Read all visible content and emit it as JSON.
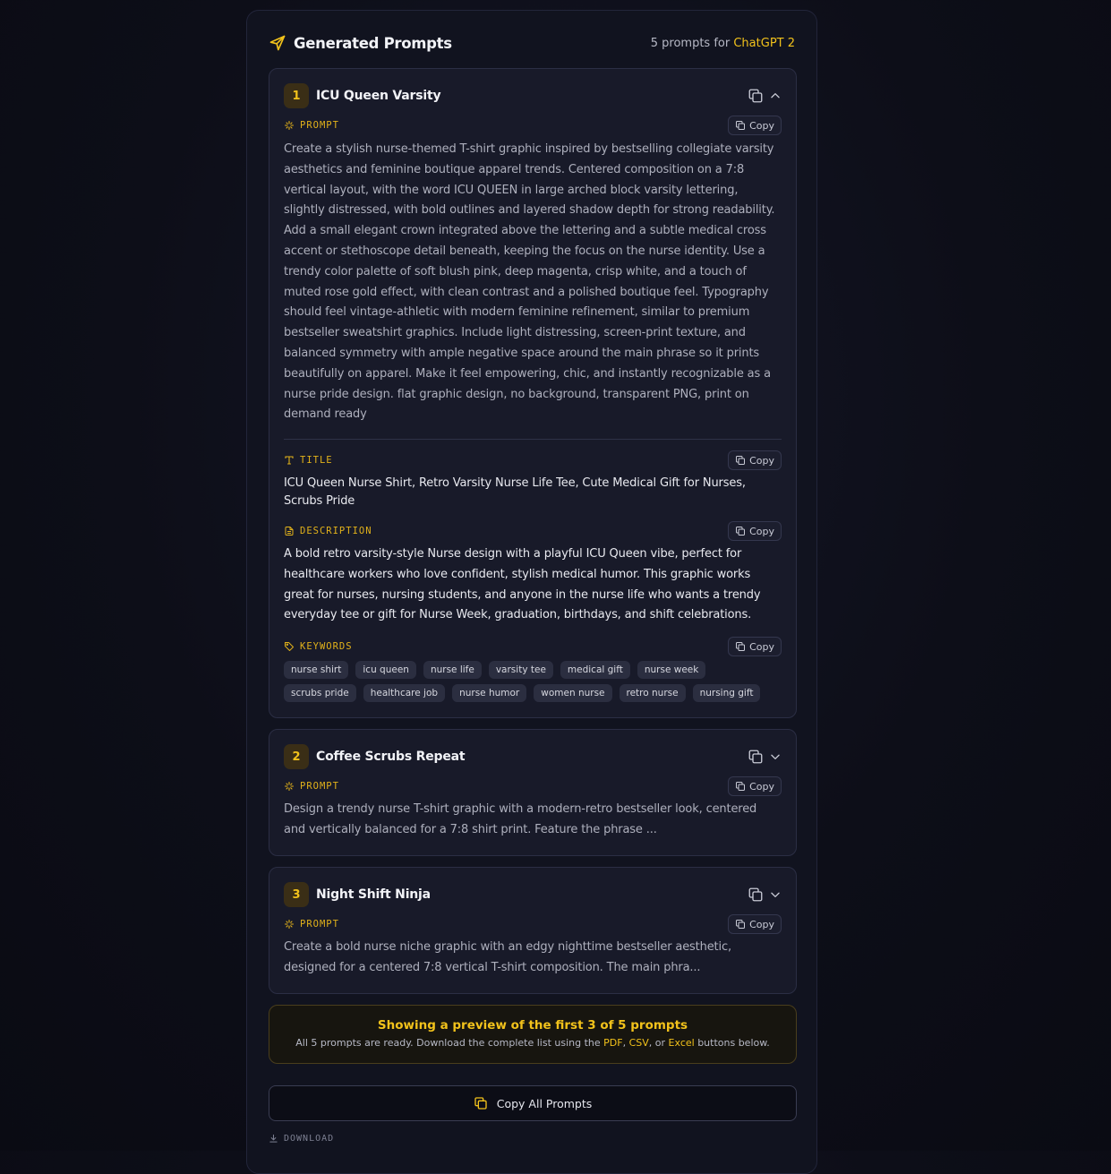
{
  "header": {
    "title": "Generated Prompts",
    "meta_prefix": "5 prompts for",
    "model": "ChatGPT 2"
  },
  "labels": {
    "prompt": "PROMPT",
    "title": "TITLE",
    "description": "DESCRIPTION",
    "keywords": "KEYWORDS",
    "copy": "Copy"
  },
  "cards": [
    {
      "number": "1",
      "name": "ICU Queen Varsity",
      "expanded": true,
      "prompt": "Create a stylish nurse-themed T-shirt graphic inspired by bestselling collegiate varsity aesthetics and feminine boutique apparel trends. Centered composition on a 7:8 vertical layout, with the word ICU QUEEN in large arched block varsity lettering, slightly distressed, with bold outlines and layered shadow depth for strong readability. Add a small elegant crown integrated above the lettering and a subtle medical cross accent or stethoscope detail beneath, keeping the focus on the nurse identity. Use a trendy color palette of soft blush pink, deep magenta, crisp white, and a touch of muted rose gold effect, with clean contrast and a polished boutique feel. Typography should feel vintage-athletic with modern feminine refinement, similar to premium bestseller sweatshirt graphics. Include light distressing, screen-print texture, and balanced symmetry with ample negative space around the main phrase so it prints beautifully on apparel. Make it feel empowering, chic, and instantly recognizable as a nurse pride design. flat graphic design, no background, transparent PNG, print on demand ready",
      "title": "ICU Queen Nurse Shirt, Retro Varsity Nurse Life Tee, Cute Medical Gift for Nurses, Scrubs Pride",
      "description": "A bold retro varsity-style Nurse design with a playful ICU Queen vibe, perfect for healthcare workers who love confident, stylish medical humor. This graphic works great for nurses, nursing students, and anyone in the nurse life who wants a trendy everyday tee or gift for Nurse Week, graduation, birthdays, and shift celebrations.",
      "keywords": [
        "nurse shirt",
        "icu queen",
        "nurse life",
        "varsity tee",
        "medical gift",
        "nurse week",
        "scrubs pride",
        "healthcare job",
        "nurse humor",
        "women nurse",
        "retro nurse",
        "nursing gift"
      ]
    },
    {
      "number": "2",
      "name": "Coffee Scrubs Repeat",
      "expanded": false,
      "prompt": "Design a trendy nurse T-shirt graphic with a modern-retro bestseller look, centered and vertically balanced for a 7:8 shirt print. Feature the phrase ..."
    },
    {
      "number": "3",
      "name": "Night Shift Ninja",
      "expanded": false,
      "prompt": "Create a bold nurse niche graphic with an edgy nighttime bestseller aesthetic, designed for a centered 7:8 vertical T-shirt composition. The main phra..."
    }
  ],
  "notice": {
    "title": "Showing a preview of the first 3 of 5 prompts",
    "body_start": "All 5 prompts are ready. Download the complete list using the",
    "pdf": "PDF",
    "sep1": ",",
    "csv": "CSV",
    "sep2": ", or",
    "excel": "Excel",
    "body_end": "buttons below."
  },
  "copy_all_label": "Copy All Prompts",
  "download_label": "DOWNLOAD",
  "colors": {
    "accent": "#f2c21b",
    "panel": "#11131f",
    "card": "#181a29"
  },
  "icons": [
    "send-icon",
    "copy-icon",
    "chevron-up-icon",
    "chevron-down-icon",
    "sparkle-icon",
    "text-type-icon",
    "document-icon",
    "tag-icon",
    "download-icon"
  ]
}
